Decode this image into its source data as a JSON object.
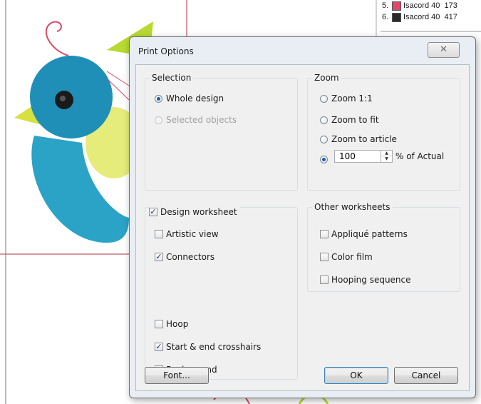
{
  "legend": [
    {
      "num": "5.",
      "color": "#dc4a67",
      "thread": "Isacord 40",
      "code": "173"
    },
    {
      "num": "6.",
      "color": "#2a2a2a",
      "thread": "Isacord 40",
      "code": "417"
    }
  ],
  "dialog": {
    "title": "Print Options",
    "close_label": "✕",
    "selection": {
      "label": "Selection",
      "whole_design": "Whole design",
      "selected_objects": "Selected objects"
    },
    "zoom": {
      "label": "Zoom",
      "zoom_1_1": "Zoom 1:1",
      "zoom_fit": "Zoom to fit",
      "zoom_article": "Zoom to article",
      "value": "100",
      "unit": "% of Actual"
    },
    "design_worksheet": {
      "label": "Design worksheet",
      "artistic_view": "Artistic view",
      "connectors": "Connectors",
      "hoop": "Hoop",
      "crosshairs": "Start & end crosshairs",
      "background": "Background"
    },
    "other_worksheets": {
      "label": "Other worksheets",
      "applique": "Appliqué patterns",
      "color_film": "Color film",
      "hooping_sequence": "Hooping sequence"
    },
    "buttons": {
      "font": "Font...",
      "ok": "OK",
      "cancel": "Cancel"
    },
    "check_mark": "✓"
  },
  "colors": {
    "accent": "#1f5aa8",
    "bird_blue": "#1f8fb8",
    "bird_green": "#b8d930",
    "frame_red": "#b03040"
  }
}
